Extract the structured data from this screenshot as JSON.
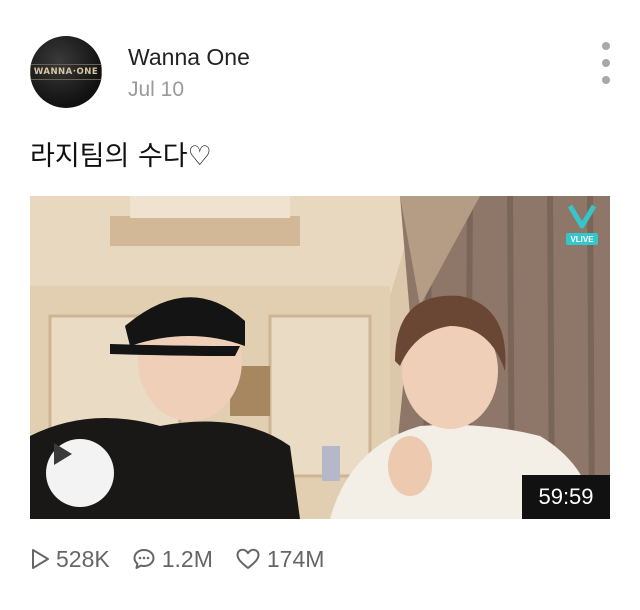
{
  "post": {
    "channel_name": "Wanna One",
    "date": "Jul 10",
    "avatar_text": "WANNA·ONE",
    "title": "라지팀의 수다♡"
  },
  "video": {
    "duration": "59:59",
    "badge_text": "VLIVE",
    "badge_color": "#35c6c9"
  },
  "stats": {
    "plays": "528K",
    "comments": "1.2M",
    "likes": "174M"
  },
  "icons": {
    "more": "more-vertical-icon",
    "play": "play-icon",
    "plays": "play-outline-icon",
    "comments": "comment-icon",
    "likes": "heart-icon"
  }
}
